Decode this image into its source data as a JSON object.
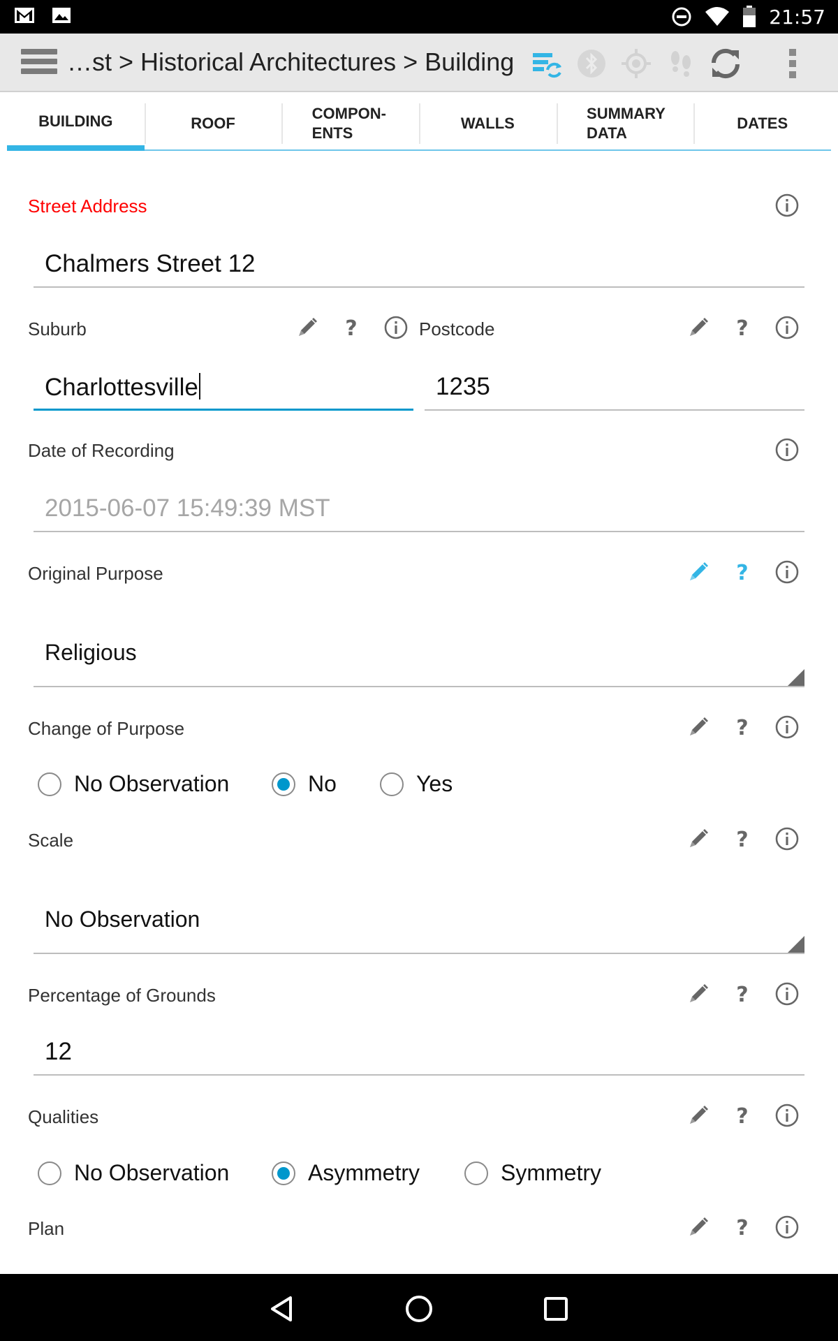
{
  "status_bar": {
    "time": "21:57",
    "left_icons": [
      "gmail-icon",
      "gallery-icon"
    ],
    "right_icons": [
      "do-not-disturb-icon",
      "wifi-icon",
      "battery-icon"
    ]
  },
  "action_bar": {
    "breadcrumb": "…st > Historical Architectures > Building",
    "icons": [
      "menu-icon",
      "sync-status-icon",
      "bluetooth-icon",
      "gps-icon",
      "footsteps-icon",
      "refresh-icon",
      "overflow-menu-icon"
    ]
  },
  "tabs": [
    {
      "label": "BUILDING",
      "active": true
    },
    {
      "label": "ROOF",
      "active": false
    },
    {
      "label": "COMPON-\nENTS",
      "active": false
    },
    {
      "label": "WALLS",
      "active": false
    },
    {
      "label": "SUMMARY\nDATA",
      "active": false
    },
    {
      "label": "DATES",
      "active": false
    }
  ],
  "form": {
    "street_address": {
      "label": "Street Address",
      "value": "Chalmers Street 12"
    },
    "suburb": {
      "label": "Suburb",
      "value": "Charlottesville"
    },
    "postcode": {
      "label": "Postcode",
      "value": "1235"
    },
    "date_of_recording": {
      "label": "Date of Recording",
      "value": "2015-06-07 15:49:39 MST"
    },
    "original_purpose": {
      "label": "Original Purpose",
      "value": "Religious"
    },
    "change_of_purpose": {
      "label": "Change of Purpose",
      "options": [
        "No Observation",
        "No",
        "Yes"
      ],
      "selected": "No"
    },
    "scale": {
      "label": "Scale",
      "value": "No Observation"
    },
    "percentage_of_grounds": {
      "label": "Percentage of Grounds",
      "value": "12"
    },
    "qualities": {
      "label": "Qualities",
      "options": [
        "No Observation",
        "Asymmetry",
        "Symmetry"
      ],
      "selected": "Asymmetry"
    },
    "plan": {
      "label": "Plan"
    }
  },
  "nav_bar": {
    "icons": [
      "back-icon",
      "home-icon",
      "recents-icon"
    ]
  },
  "colors": {
    "accent": "#33b5e5",
    "focus": "#0097cc",
    "required": "#ff0000",
    "icon_gray": "#666666"
  }
}
